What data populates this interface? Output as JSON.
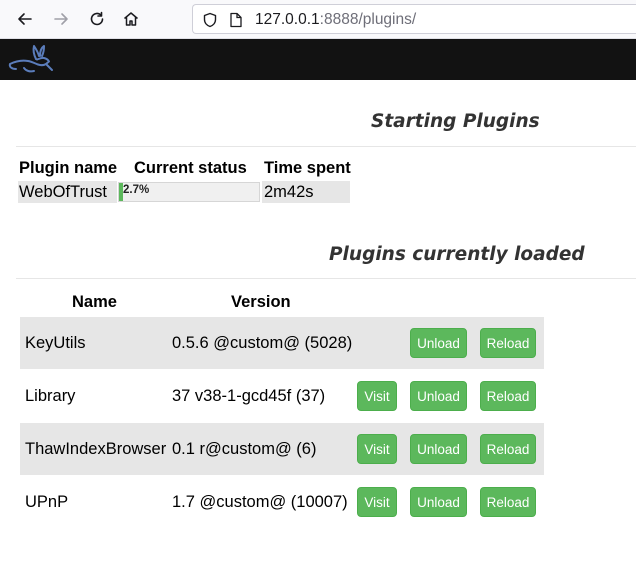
{
  "browser": {
    "url_host": "127.0.0.1",
    "url_rest": ":8888/plugins/"
  },
  "starting": {
    "title": "Starting Plugins",
    "headers": [
      "Plugin name",
      "Current status",
      "Time spent"
    ],
    "rows": [
      {
        "name": "WebOfTrust",
        "progress_label": "2.7%",
        "progress_fraction": 0.027,
        "time": "2m42s"
      }
    ]
  },
  "loaded": {
    "title": "Plugins currently loaded",
    "headers": [
      "Name",
      "Version"
    ],
    "buttons": {
      "visit": "Visit",
      "unload": "Unload",
      "reload": "Reload"
    },
    "rows": [
      {
        "name": "KeyUtils",
        "version": "0.5.6 @custom@ (5028)",
        "has_visit": false
      },
      {
        "name": "Library",
        "version": "37 v38-1-gcd45f (37)",
        "has_visit": true
      },
      {
        "name": "ThawIndexBrowser",
        "version": "0.1 r@custom@ (6)",
        "has_visit": true
      },
      {
        "name": "UPnP",
        "version": "1.7 @custom@ (10007)",
        "has_visit": true
      }
    ]
  },
  "colors": {
    "button": "#5cb85c",
    "row_shade": "#e6e6e6",
    "header_bar": "#121212"
  }
}
